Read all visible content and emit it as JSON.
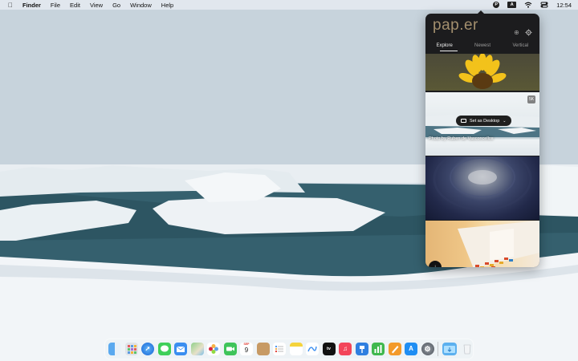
{
  "menubar": {
    "apple_icon": "apple-logo-icon",
    "app_name": "Finder",
    "menus": [
      "File",
      "Edit",
      "View",
      "Go",
      "Window",
      "Help"
    ],
    "status": {
      "paper_icon": "P",
      "input_source": "A",
      "clock": "12:54"
    }
  },
  "popover": {
    "logo": "pap.er",
    "tabs": [
      "Explore",
      "Newest",
      "Vertical"
    ],
    "active_tab": "Explore",
    "tile_action": "Set as Desktop",
    "tile_caption": "Photo by Ruben de Vasconcellos",
    "small_badge": "5K",
    "scroll_icon": "arrow-down-icon"
  },
  "dock": {
    "apps": [
      "Finder",
      "Launchpad",
      "Safari",
      "Messages",
      "Mail",
      "Maps",
      "Photos",
      "FaceTime",
      "Calendar",
      "Contacts",
      "Reminders",
      "Notes",
      "Freeform",
      "TV",
      "Music",
      "Keynote",
      "Numbers",
      "Pages",
      "App Store",
      "System Settings",
      "Downloads",
      "Trash"
    ],
    "calendar": {
      "month": "SEP",
      "day": "9"
    },
    "app_store_label": "A",
    "tv_label": "tv"
  },
  "colors": {
    "popover_bg": "#1c1c1e",
    "logo": "#a38f6e",
    "menubar": "#e6ecf2"
  }
}
